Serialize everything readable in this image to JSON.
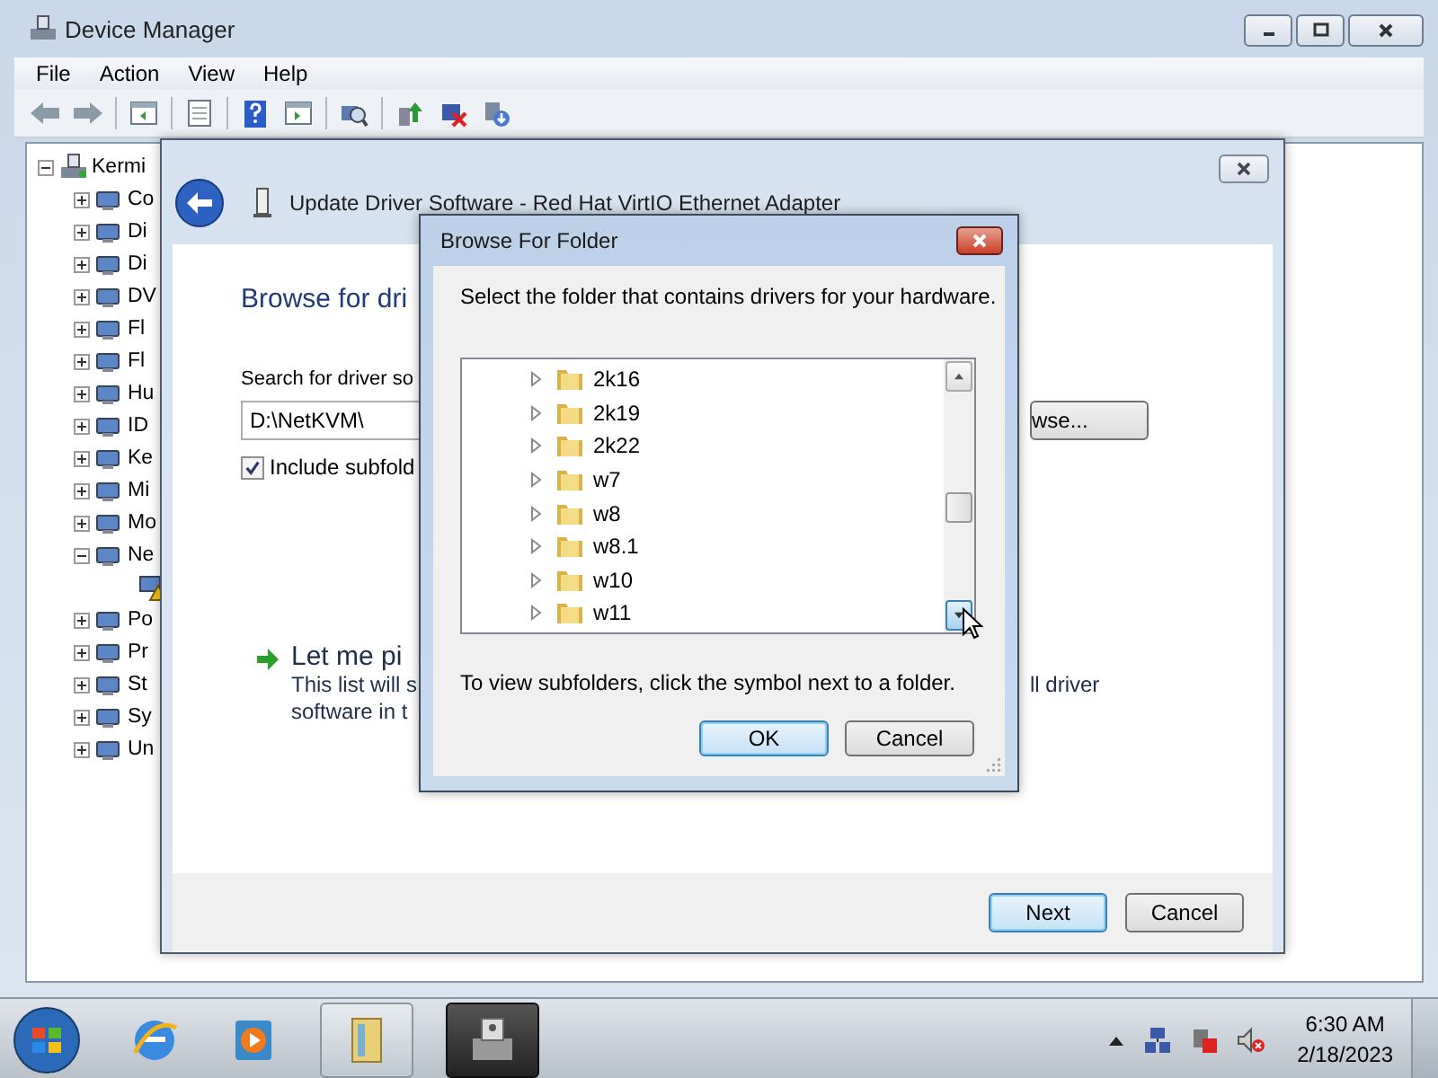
{
  "window": {
    "title": "Device Manager"
  },
  "menu": [
    "File",
    "Action",
    "View",
    "Help"
  ],
  "tree": {
    "label": "Kermi",
    "expanded": true,
    "children": [
      {
        "label": "Co",
        "expanded": false
      },
      {
        "label": "Di",
        "expanded": false
      },
      {
        "label": "Di",
        "expanded": false
      },
      {
        "label": "DV",
        "expanded": false
      },
      {
        "label": "Fl",
        "expanded": false
      },
      {
        "label": "Fl",
        "expanded": false
      },
      {
        "label": "Hu",
        "expanded": false
      },
      {
        "label": "ID",
        "expanded": false
      },
      {
        "label": "Ke",
        "expanded": false
      },
      {
        "label": "Mi",
        "expanded": false
      },
      {
        "label": "Mo",
        "expanded": false
      },
      {
        "label": "Ne",
        "expanded": true,
        "children": [
          {
            "warning": true
          }
        ]
      },
      {
        "label": "Po",
        "expanded": false
      },
      {
        "label": "Pr",
        "expanded": false
      },
      {
        "label": "St",
        "expanded": false
      },
      {
        "label": "Sy",
        "expanded": false
      },
      {
        "label": "Un",
        "expanded": false
      }
    ]
  },
  "wizard": {
    "title": "Update Driver Software - Red Hat VirtIO Ethernet Adapter",
    "heading": "Browse for dri",
    "search_label": "Search for driver so",
    "path": "D:\\NetKVM\\",
    "browse_button": "wse...",
    "include_subfolders": {
      "label": "Include subfold",
      "checked": true
    },
    "option": {
      "title": "Let me pi",
      "line_1": "This list will s",
      "line_1_end": "ll driver",
      "line_2": "software in t"
    },
    "buttons": [
      {
        "label": "Next",
        "default": true
      },
      {
        "label": "Cancel",
        "default": false
      }
    ]
  },
  "dialog": {
    "title": "Browse For Folder",
    "instruction": "Select the folder that contains drivers for your hardware.",
    "folders": [
      {
        "label": "2k16",
        "expanded": false
      },
      {
        "label": "2k19",
        "expanded": false
      },
      {
        "label": "2k22",
        "expanded": false
      },
      {
        "label": "w7",
        "expanded": false
      },
      {
        "label": "w8",
        "expanded": false
      },
      {
        "label": "w8.1",
        "expanded": false
      },
      {
        "label": "w10",
        "expanded": false
      },
      {
        "label": "w11",
        "expanded": false
      }
    ],
    "hint": "To view subfolders, click the symbol next to a folder.",
    "buttons": [
      {
        "label": "OK",
        "default": true
      },
      {
        "label": "Cancel",
        "default": false
      }
    ]
  },
  "taskbar": {
    "time": "6:30 AM",
    "date": "2/18/2023"
  }
}
